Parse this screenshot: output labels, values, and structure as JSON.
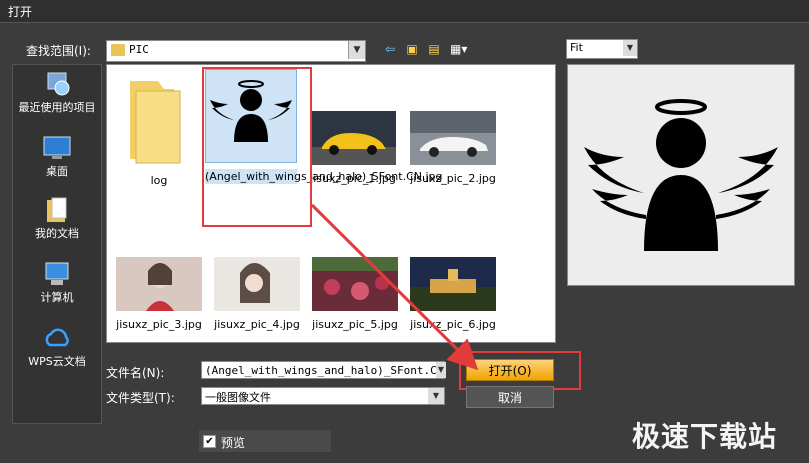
{
  "window": {
    "title": "打开"
  },
  "lookin": {
    "label": "查找范围(I):",
    "value": "PIC"
  },
  "toolbar": {
    "icons": [
      "back-icon",
      "up-folder-icon",
      "new-folder-icon",
      "view-menu-icon"
    ]
  },
  "places": [
    {
      "label": "最近使用的项目",
      "icon": "recent-icon"
    },
    {
      "label": "桌面",
      "icon": "desktop-icon"
    },
    {
      "label": "我的文档",
      "icon": "documents-icon"
    },
    {
      "label": "计算机",
      "icon": "computer-icon"
    },
    {
      "label": "WPS云文档",
      "icon": "cloud-icon"
    }
  ],
  "files": [
    {
      "name": "log",
      "type": "folder"
    },
    {
      "name": "(Angel_with_wings_and_halo)_SFont.CN.jpg",
      "type": "image",
      "selected": true
    },
    {
      "name": "jisuxz_pic_1.jpg",
      "type": "image"
    },
    {
      "name": "jisuxz_pic_2.jpg",
      "type": "image"
    },
    {
      "name": "jisuxz_pic_3.jpg",
      "type": "image"
    },
    {
      "name": "jisuxz_pic_4.jpg",
      "type": "image"
    },
    {
      "name": "jisuxz_pic_5.jpg",
      "type": "image"
    },
    {
      "name": "jisuxz_pic_6.jpg",
      "type": "image"
    }
  ],
  "fit": {
    "value": "Fit"
  },
  "filename": {
    "label": "文件名(N):",
    "value": "(Angel_with_wings_and_halo)_SFont.CN."
  },
  "filetype": {
    "label": "文件类型(T):",
    "value": "一般图像文件"
  },
  "buttons": {
    "open": "打开(O)",
    "cancel": "取消"
  },
  "preview_toggle": {
    "label": "预览",
    "checked": true
  },
  "watermark": "极速下载站"
}
